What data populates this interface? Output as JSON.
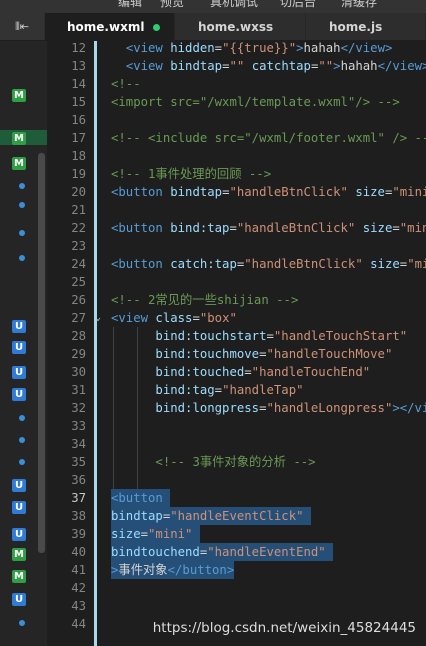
{
  "menu": [
    "编辑",
    "预览",
    "真机调试",
    "切后台",
    "清缓存"
  ],
  "tabs": [
    {
      "label": "home.wxml",
      "active": true,
      "modified": true
    },
    {
      "label": "home.wxss",
      "active": false,
      "modified": false
    },
    {
      "label": "home.js",
      "active": false,
      "modified": false
    }
  ],
  "explorer_toggle": "⫴⇤",
  "sidebar_badges": {
    "m": "M",
    "u": "U"
  },
  "watermark": "https://blog.csdn.net/weixin_45824445",
  "lines": [
    {
      "n": "12",
      "segs": [
        [
          "pl",
          "  "
        ],
        [
          "tg",
          "<view"
        ],
        [
          "at",
          " hidden"
        ],
        [
          "pl",
          "="
        ],
        [
          "st",
          "\"{{true}}\""
        ],
        [
          "tg",
          ">"
        ],
        [
          "pl",
          "hahah"
        ],
        [
          "tg",
          "</view>"
        ]
      ]
    },
    {
      "n": "13",
      "segs": [
        [
          "pl",
          "  "
        ],
        [
          "tg",
          "<view"
        ],
        [
          "at",
          " bindtap"
        ],
        [
          "pl",
          "="
        ],
        [
          "st",
          "\"\""
        ],
        [
          "at",
          " catchtap"
        ],
        [
          "pl",
          "="
        ],
        [
          "st",
          "\"\""
        ],
        [
          "tg",
          ">"
        ],
        [
          "pl",
          "hahah"
        ],
        [
          "tg",
          "</view>"
        ]
      ]
    },
    {
      "n": "14",
      "segs": [
        [
          "cm",
          "<!--"
        ]
      ]
    },
    {
      "n": "15",
      "segs": [
        [
          "cm",
          "<import src=\"/wxml/template.wxml\"/> -->"
        ]
      ]
    },
    {
      "n": "16",
      "segs": []
    },
    {
      "n": "17",
      "segs": [
        [
          "cm",
          "<!-- <include src=\"/wxml/footer.wxml\" /> -->"
        ]
      ]
    },
    {
      "n": "18",
      "segs": []
    },
    {
      "n": "19",
      "segs": [
        [
          "cm",
          "<!-- 1事件处理的回顾 -->"
        ]
      ]
    },
    {
      "n": "20",
      "segs": [
        [
          "tg",
          "<button"
        ],
        [
          "at",
          " bindtap"
        ],
        [
          "pl",
          "="
        ],
        [
          "st",
          "\"handleBtnClick\""
        ],
        [
          "at",
          " size"
        ],
        [
          "pl",
          "="
        ],
        [
          "st",
          "\"mini\""
        ],
        [
          "tg",
          ">"
        ]
      ]
    },
    {
      "n": "21",
      "segs": []
    },
    {
      "n": "22",
      "segs": [
        [
          "tg",
          "<button"
        ],
        [
          "at",
          " bind:tap"
        ],
        [
          "pl",
          "="
        ],
        [
          "st",
          "\"handleBtnClick\""
        ],
        [
          "at",
          " size"
        ],
        [
          "pl",
          "="
        ],
        [
          "st",
          "\"mini\""
        ],
        [
          "tg",
          ">"
        ]
      ]
    },
    {
      "n": "23",
      "segs": []
    },
    {
      "n": "24",
      "segs": [
        [
          "tg",
          "<button"
        ],
        [
          "at",
          " catch:tap"
        ],
        [
          "pl",
          "="
        ],
        [
          "st",
          "\"handleBtnClick\""
        ],
        [
          "at",
          " size"
        ],
        [
          "pl",
          "="
        ],
        [
          "st",
          "\"mini\""
        ],
        [
          "tg",
          ">"
        ]
      ]
    },
    {
      "n": "25",
      "segs": []
    },
    {
      "n": "26",
      "segs": [
        [
          "cm",
          "<!-- 2常见的一些shijian -->"
        ]
      ]
    },
    {
      "n": "27",
      "fold": true,
      "segs": [
        [
          "tg",
          "<view"
        ],
        [
          "at",
          " class"
        ],
        [
          "pl",
          "="
        ],
        [
          "st",
          "\"box\""
        ]
      ]
    },
    {
      "n": "28",
      "segs": [
        [
          "pl",
          "      "
        ],
        [
          "at",
          "bind:touchstart"
        ],
        [
          "pl",
          "="
        ],
        [
          "st",
          "\"handleTouchStart\""
        ]
      ]
    },
    {
      "n": "29",
      "segs": [
        [
          "pl",
          "      "
        ],
        [
          "at",
          "bind:touchmove"
        ],
        [
          "pl",
          "="
        ],
        [
          "st",
          "\"handleTouchMove\""
        ]
      ]
    },
    {
      "n": "30",
      "segs": [
        [
          "pl",
          "      "
        ],
        [
          "at",
          "bind:touched"
        ],
        [
          "pl",
          "="
        ],
        [
          "st",
          "\"handleTouchEnd\""
        ]
      ]
    },
    {
      "n": "31",
      "segs": [
        [
          "pl",
          "      "
        ],
        [
          "at",
          "bind:tag"
        ],
        [
          "pl",
          "="
        ],
        [
          "st",
          "\"handleTap\""
        ]
      ]
    },
    {
      "n": "32",
      "segs": [
        [
          "pl",
          "      "
        ],
        [
          "at",
          "bind:longpress"
        ],
        [
          "pl",
          "="
        ],
        [
          "st",
          "\"handleLongpress\""
        ],
        [
          "tg",
          "></view>"
        ]
      ]
    },
    {
      "n": "33",
      "segs": []
    },
    {
      "n": "34",
      "segs": []
    },
    {
      "n": "35",
      "segs": [
        [
          "pl",
          "      "
        ],
        [
          "cm",
          "<!-- 3事件对象的分析 -->"
        ]
      ]
    },
    {
      "n": "36",
      "segs": []
    },
    {
      "n": "37",
      "cur": true,
      "sel": true,
      "segs": [
        [
          "tg",
          "<button "
        ]
      ]
    },
    {
      "n": "38",
      "sel": true,
      "segs": [
        [
          "at",
          "bindtap"
        ],
        [
          "pl",
          "="
        ],
        [
          "st",
          "\"handleEventClick\" "
        ]
      ]
    },
    {
      "n": "39",
      "sel": true,
      "segs": [
        [
          "at",
          "size"
        ],
        [
          "pl",
          "="
        ],
        [
          "st",
          "\"mini\" "
        ]
      ]
    },
    {
      "n": "40",
      "sel": true,
      "segs": [
        [
          "at",
          "bindtouchend"
        ],
        [
          "pl",
          "="
        ],
        [
          "st",
          "\"handleEventEnd\" "
        ]
      ]
    },
    {
      "n": "41",
      "sel": true,
      "segs": [
        [
          "tg",
          ">"
        ],
        [
          "pl",
          "事件对象"
        ],
        [
          "tg",
          "</button>"
        ]
      ]
    },
    {
      "n": "42",
      "segs": []
    },
    {
      "n": "43",
      "segs": []
    },
    {
      "n": "44",
      "segs": []
    }
  ]
}
